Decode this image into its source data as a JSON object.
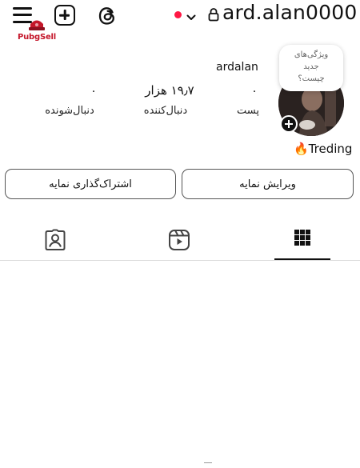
{
  "header": {
    "username": "ard.alan0000",
    "logo_text": "PubgSell",
    "live_dot_color": "#ff1744"
  },
  "profile": {
    "display_name": "ardalan",
    "note": [
      "ویژگی‌های",
      "جدید",
      "چیست؟"
    ],
    "bio": "🔥Treding",
    "stats": {
      "posts": {
        "value": "۰",
        "label": "پست"
      },
      "followers": {
        "value": "۱۹٫۷ هزار",
        "label": "دنبال‌کننده"
      },
      "following": {
        "value": "۰",
        "label": "دنبال‌شونده"
      }
    }
  },
  "actions": {
    "edit_label": "ویرایش نمایه",
    "share_label": "اشتراک‌گذاری نمایه"
  },
  "tabs": [
    {
      "icon": "grid-icon",
      "active": true
    },
    {
      "icon": "reels-icon",
      "active": false
    },
    {
      "icon": "tagged-icon",
      "active": false
    }
  ]
}
